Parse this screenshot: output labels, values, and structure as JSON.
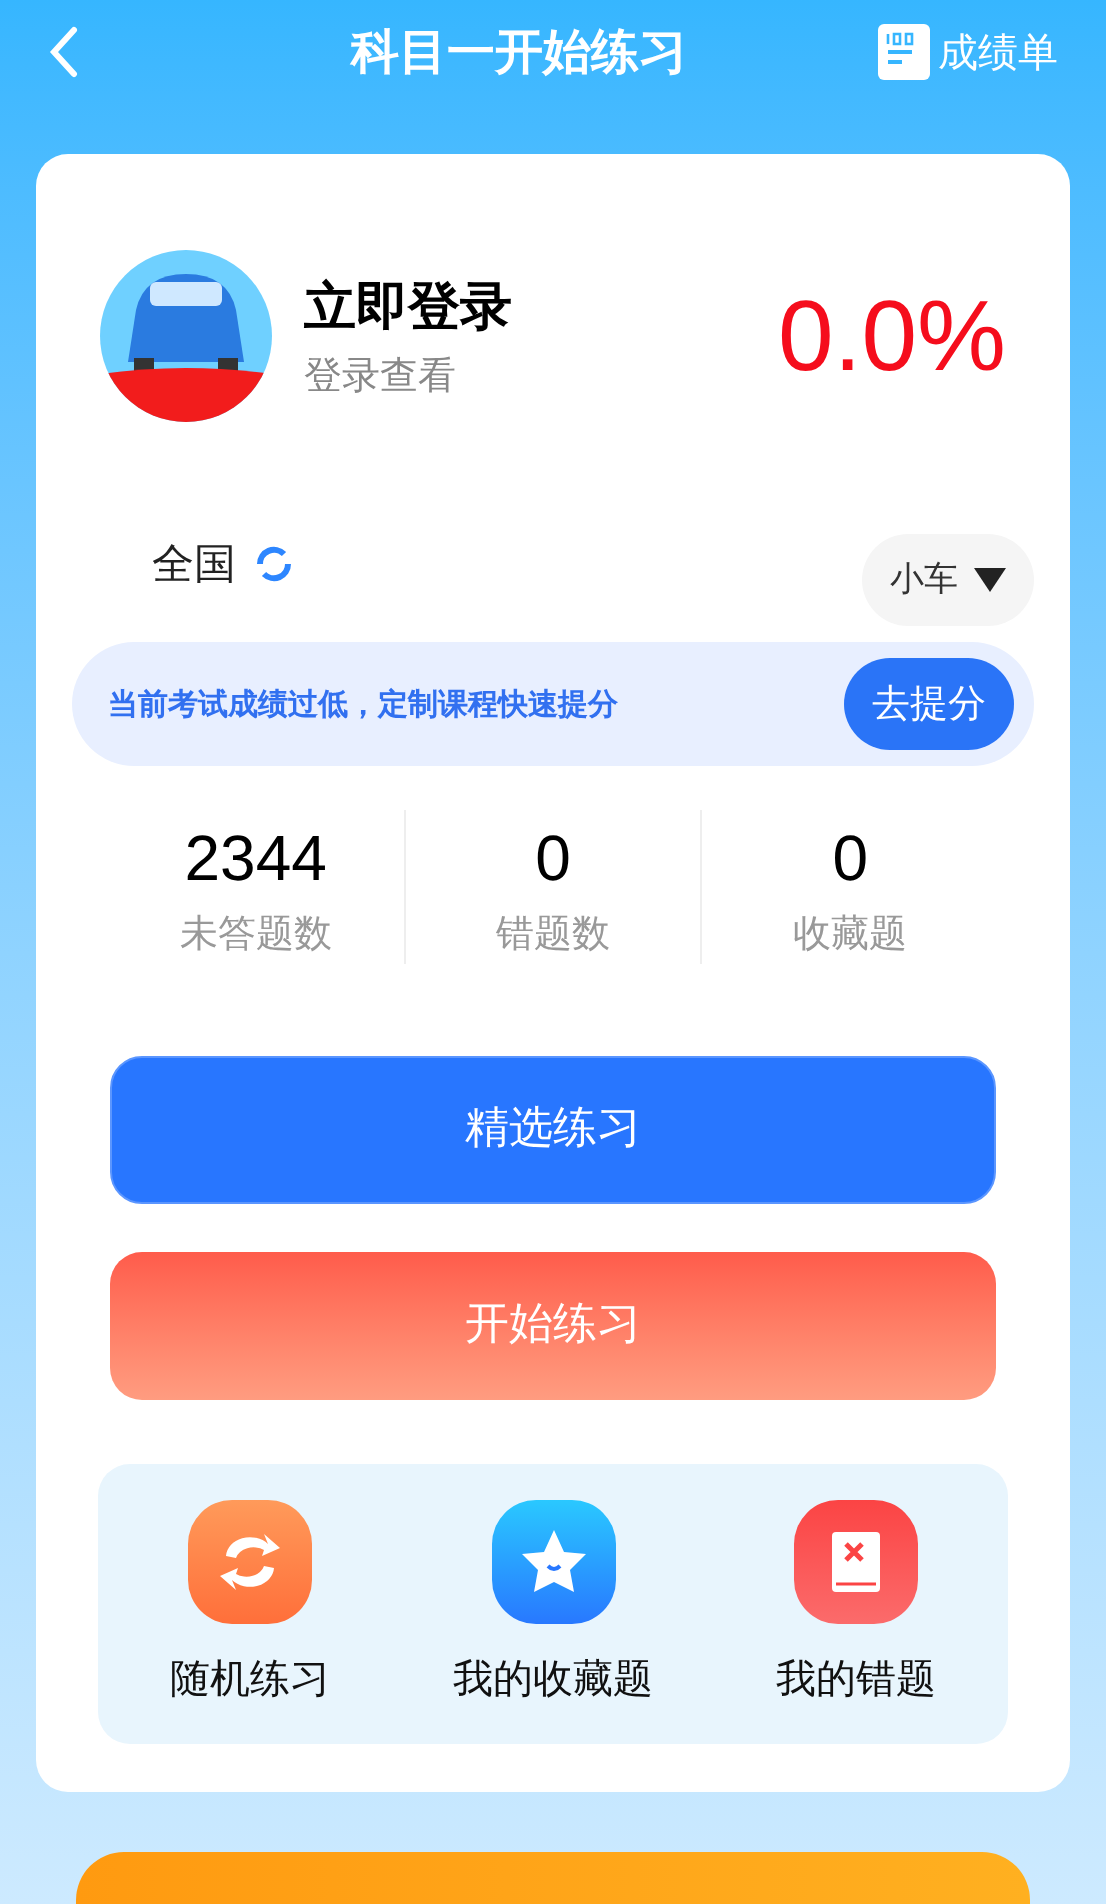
{
  "header": {
    "title": "科目一开始练习",
    "report_label": "成绩单"
  },
  "profile": {
    "name": "立即登录",
    "subtitle": "登录查看",
    "score": "0.0%"
  },
  "region": {
    "label": "全国",
    "vehicle": "小车"
  },
  "promo": {
    "text": "当前考试成绩过低，定制课程快速提分",
    "button": "去提分"
  },
  "stats": [
    {
      "value": "2344",
      "label": "未答题数"
    },
    {
      "value": "0",
      "label": "错题数"
    },
    {
      "value": "0",
      "label": "收藏题"
    }
  ],
  "actions": [
    {
      "kind": "primary",
      "label": "精选练习"
    },
    {
      "kind": "secondary",
      "label": "开始练习"
    }
  ],
  "shortcuts": [
    {
      "kind": "random",
      "label": "随机练习"
    },
    {
      "kind": "favorite",
      "label": "我的收藏题"
    },
    {
      "kind": "wrong",
      "label": "我的错题"
    }
  ]
}
